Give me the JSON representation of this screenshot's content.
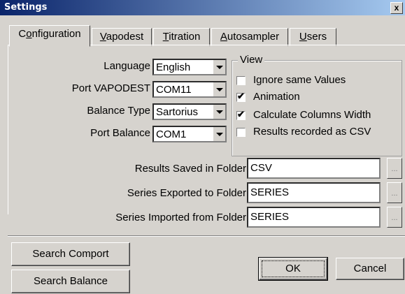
{
  "window": {
    "title": "Settings",
    "close_label": "x"
  },
  "tabs": [
    {
      "label": "Configuration",
      "u": "o"
    },
    {
      "label": "Vapodest",
      "u": "V"
    },
    {
      "label": "Titration",
      "u": "T"
    },
    {
      "label": "Autosampler",
      "u": "A"
    },
    {
      "label": "Users",
      "u": "U"
    }
  ],
  "config": {
    "language_label": "Language",
    "language_value": "English",
    "port_vapodest_label": "Port VAPODEST",
    "port_vapodest_value": "COM11",
    "balance_type_label": "Balance Type",
    "balance_type_value": "Sartorius",
    "port_balance_label": "Port Balance",
    "port_balance_value": "COM1"
  },
  "view": {
    "title": "View",
    "options": [
      {
        "label": "Ignore same Values",
        "checked": false
      },
      {
        "label": "Animation",
        "checked": true
      },
      {
        "label": "Calculate Columns Width",
        "checked": true
      },
      {
        "label": "Results recorded as CSV",
        "checked": false
      }
    ]
  },
  "folders": {
    "results_label": "Results Saved in Folder",
    "results_value": "CSV",
    "exported_label": "Series Exported to Folder",
    "exported_value": "SERIES",
    "imported_label": "Series Imported from Folder",
    "imported_value": "SERIES",
    "browse_label": "..."
  },
  "buttons": {
    "search_comport": "Search Comport",
    "search_balance": "Search Balance",
    "ok": "OK",
    "cancel": "Cancel"
  }
}
